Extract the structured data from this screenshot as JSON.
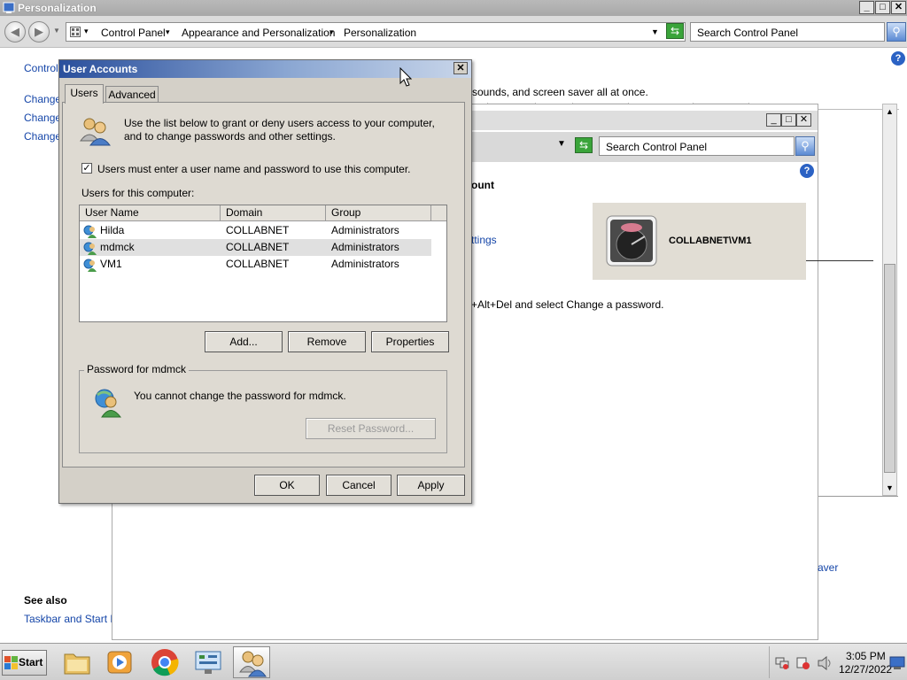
{
  "window": {
    "title": "Personalization",
    "buttons": {
      "minimize": "_",
      "maximize": "□",
      "close": "✕"
    }
  },
  "addressbar": {
    "breadcrumbs": [
      "Control Panel",
      "Appearance and Personalization",
      "Personalization"
    ],
    "search_placeholder": "Search Control Panel"
  },
  "left_pane": {
    "links": [
      "Control",
      "Change",
      "Change",
      "Change"
    ],
    "see_also_heading": "See also",
    "see_also_link": "Taskbar and Start M"
  },
  "main": {
    "intro_fragment": "sounds, and screen saver all at once.",
    "screen_saver_fragment": "aver"
  },
  "bg_window": {
    "search_placeholder": "Search Control Panel",
    "heading_fragment": "ount",
    "settings_fragment": "ttings",
    "ctrl_alt_del_text": "+Alt+Del and select Change a password.",
    "account_name": "COLLABNET\\VM1"
  },
  "dialog": {
    "title": "User Accounts",
    "tabs": [
      "Users",
      "Advanced"
    ],
    "intro": "Use the list below to grant or deny users access to your computer, and to change passwords and other settings.",
    "checkbox_label": "Users must enter a user name and password to use this computer.",
    "users_label": "Users for this computer:",
    "columns": [
      "User Name",
      "Domain",
      "Group"
    ],
    "users": [
      {
        "name": "Hilda",
        "domain": "COLLABNET",
        "group": "Administrators"
      },
      {
        "name": "mdmck",
        "domain": "COLLABNET",
        "group": "Administrators"
      },
      {
        "name": "VM1",
        "domain": "COLLABNET",
        "group": "Administrators"
      }
    ],
    "buttons": {
      "add": "Add...",
      "remove": "Remove",
      "properties": "Properties"
    },
    "password_group_label": "Password for mdmck",
    "password_text": "You cannot change the password for mdmck.",
    "reset_password": "Reset Password...",
    "footer": {
      "ok": "OK",
      "cancel": "Cancel",
      "apply": "Apply"
    }
  },
  "taskbar": {
    "start": "Start",
    "time": "3:05 PM",
    "date": "12/27/2022"
  }
}
